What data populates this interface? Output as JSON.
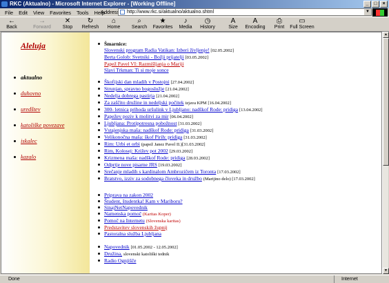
{
  "window": {
    "title": "RKC (Aktualno) - Microsoft Internet Explorer - [Working Offline]"
  },
  "menu": [
    "File",
    "Edit",
    "View",
    "Favorites",
    "Tools",
    "Help"
  ],
  "address": {
    "label": "Address",
    "url": "http://www.rkc.si/aktualno/aktualno.shtml"
  },
  "toolbar": [
    {
      "label": "Back",
      "icon": "←"
    },
    {
      "label": "Forward",
      "icon": "→"
    },
    {
      "label": "Stop",
      "icon": "✕"
    },
    {
      "label": "Refresh",
      "icon": "↻"
    },
    {
      "label": "Home",
      "icon": "⌂"
    },
    {
      "label": "Search",
      "icon": "⌕"
    },
    {
      "label": "Favorites",
      "icon": "★"
    },
    {
      "label": "Media",
      "icon": "♪"
    },
    {
      "label": "History",
      "icon": "◷"
    },
    {
      "label": "Size",
      "icon": "A"
    },
    {
      "label": "Encoding",
      "icon": "A"
    },
    {
      "label": "Print",
      "icon": "⎙"
    },
    {
      "label": "Full Screen",
      "icon": "▭"
    }
  ],
  "sidebar": {
    "brand": "Aleluja",
    "items": [
      {
        "label": "aktualno",
        "active": true
      },
      {
        "label": "duhovno"
      },
      {
        "label": "uredštev"
      },
      {
        "label": "katoliške povezave"
      },
      {
        "label": "iskalec"
      },
      {
        "label": "kazalo"
      }
    ]
  },
  "main": {
    "sharnice_title": "Šmarnice:",
    "sharnice": [
      {
        "link": "Slovenski program Radia Vatikan: Izberi življenje!",
        "extra": "[02.05.2002]"
      },
      {
        "link": "Berta Golob: Svetniki - Božji prijatelji",
        "extra": "[03.05.2002]"
      },
      {
        "link": "Papež Pavel VI: Razmišljanja o Mariji",
        "extra": ""
      },
      {
        "link": "Slavi Trkman: Ti si moje sonce",
        "extra": ""
      }
    ],
    "news": [
      {
        "link": "Škofijski dan mladih v Postojni",
        "extra": "[27.04.2002]"
      },
      {
        "link": "Strunjan, spravno bogoslužje",
        "extra": "[21.04.2002]"
      },
      {
        "link": "Nedelja dobrega pastirja",
        "extra": "[21.04.2002]"
      },
      {
        "link": "Za zaščito družine in nedeljski počitek",
        "extra": "izjava KPM [16.04.2002]"
      },
      {
        "link": "300- letnica prihoda uršulink v Ljubljano: nadškof Rode: pridiga",
        "extra": "[13.04.2002]"
      },
      {
        "link": "Papežev poziv k molitvi za mir",
        "extra": "[06.04.2002]"
      },
      {
        "link": "Ljubljana: Protipotresna pobožnost",
        "extra": "[31.03.2002]"
      },
      {
        "link": "Vstajenjska maša: nadškof Rode: pridiga",
        "extra": "[31.03.2002]"
      },
      {
        "link": "Velikonočna maša: škof Pirih: pridiga",
        "extra": "[31.03.2002]"
      },
      {
        "link": "Rim: Urbi et orbi",
        "extra": "(papež Janez Pavel II.)[31.03.2002]"
      },
      {
        "link": "Rim, Kolosej: Križev pot 2002",
        "extra": "[29.03.2002]"
      },
      {
        "link": "Krizmena maša: nadškof Rode: pridiga",
        "extra": "[28.03.2002]"
      },
      {
        "link": "Odprtje nove pisarne JRS",
        "extra": "[19.03.2002]"
      },
      {
        "link": "Srečanje mladih s kardinalom Ambrozičem iz Toronta",
        "extra": "[17.03.2002]"
      },
      {
        "link": "Bratstvo, izziv za sodobnega človeka in družbo",
        "extra": "(Marijino delo) [17.03.2002]"
      }
    ],
    "links": [
      {
        "link": "Priprava na zakon 2002",
        "extra": "",
        "red": false
      },
      {
        "link": "Študent, študentka! Kam v Mariboru?",
        "extra": "",
        "red": false
      },
      {
        "link": "SinajNetNapovednik",
        "extra": "",
        "red": false
      },
      {
        "link": "Namenska pomoč",
        "extra": "(Karitas Koper)",
        "red": true
      },
      {
        "link": "Pomoč na Internetu",
        "extra": "(Slovenska karitas)",
        "red": true
      },
      {
        "link": "Predstavitev slovenskih župnij",
        "extra": "",
        "red": false
      },
      {
        "link": "Pastoralna služba Ljubljana",
        "extra": "",
        "red": false
      }
    ],
    "bottom": [
      {
        "link": "Napovednik",
        "extra": "[01.05.2002 - 12.05.2002]"
      },
      {
        "link": "Družina,",
        "extra": "slovenski katoliški tednik"
      },
      {
        "link": "Radio Ognjišče",
        "extra": ""
      }
    ]
  },
  "status": {
    "left": "Done",
    "zone": "Internet"
  },
  "colors": {
    "link": "#0000cc",
    "accent": "#b00000",
    "titlebar": "#0a246a"
  }
}
